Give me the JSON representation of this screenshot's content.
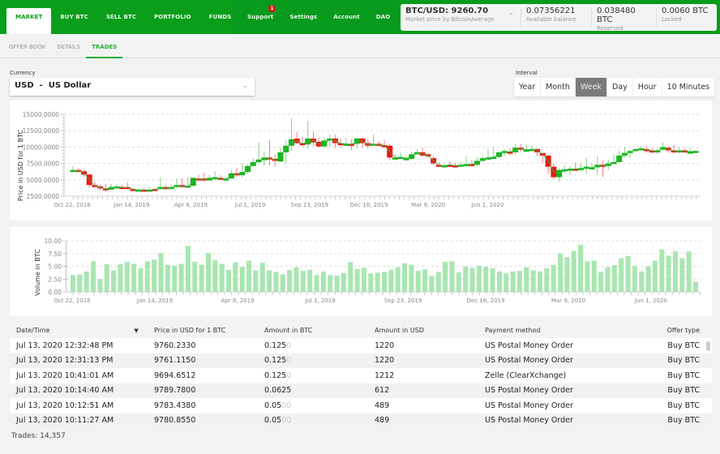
{
  "nav": {
    "left": [
      "MARKET",
      "BUY BTC",
      "SELL BTC",
      "PORTFOLIO",
      "FUNDS"
    ],
    "active": "MARKET",
    "right": [
      "Support",
      "Settings",
      "Account",
      "DAO"
    ],
    "support_badge": "1"
  },
  "market": {
    "price": "BTC/USD: 9260.70",
    "price_source": "Market price by BitcoinAverage",
    "available_balance": "0.07356221",
    "available_label": "Available balance",
    "reserved": "0.038480 BTC",
    "reserved_label": "Reserved",
    "locked": "0.0060 BTC",
    "locked_label": "Locked"
  },
  "tabs": [
    "OFFER BOOK",
    "DETAILS",
    "TRADES"
  ],
  "active_tab": "TRADES",
  "currency": {
    "label": "Currency",
    "value": "USD  -  US Dollar"
  },
  "interval": {
    "label": "Interval",
    "options": [
      "Year",
      "Month",
      "Week",
      "Day",
      "Hour",
      "10 Minutes"
    ],
    "selected": "Week"
  },
  "colors": {
    "brand": "#0b9e1b",
    "up": "#17b51b",
    "down": "#f01616",
    "volume": "#a8e6b0"
  },
  "chart_data": [
    {
      "type": "candlestick",
      "ylabel": "Price in USD for 1 BTC",
      "ylim": [
        2500,
        15000
      ],
      "yticks": [
        "15000.0000",
        "12500.0000",
        "10000.0000",
        "7500.0000",
        "5000.0000",
        "2500.0000"
      ],
      "xticks": [
        "Oct 22, 2018",
        "Jan 14, 2019",
        "Apr 8, 2019",
        "Jul 1, 2019",
        "Sep 23, 2019",
        "Dec 16, 2019",
        "Mar 9, 2020",
        "Jun 1, 2020"
      ],
      "grid": true,
      "candles": [
        [
          6300,
          6500,
          7100,
          6200
        ],
        [
          6500,
          6300,
          6800,
          6200
        ],
        [
          6300,
          5800,
          6600,
          5500
        ],
        [
          5800,
          4200,
          5900,
          3800
        ],
        [
          4200,
          4000,
          4700,
          3900
        ],
        [
          4000,
          3700,
          4300,
          3300
        ],
        [
          3700,
          3400,
          4400,
          3200
        ],
        [
          3500,
          3900,
          4400,
          3400
        ],
        [
          3900,
          4000,
          4300,
          3600
        ],
        [
          3900,
          3800,
          4200,
          3600
        ],
        [
          3900,
          3700,
          4600,
          3500
        ],
        [
          3600,
          3500,
          3800,
          3400
        ],
        [
          3400,
          3500,
          3700,
          3300
        ],
        [
          3500,
          3400,
          3700,
          3300
        ],
        [
          3400,
          3500,
          3900,
          3300
        ],
        [
          3600,
          3400,
          3700,
          3300
        ],
        [
          3600,
          3900,
          5300,
          3500
        ],
        [
          3900,
          3600,
          4200,
          3500
        ],
        [
          3700,
          3900,
          4300,
          3700
        ],
        [
          3900,
          4200,
          5200,
          3800
        ],
        [
          4200,
          3900,
          5200,
          3800
        ],
        [
          3900,
          4100,
          5400,
          3900
        ],
        [
          4100,
          5300,
          5400,
          4000
        ],
        [
          5200,
          5100,
          5800,
          5000
        ],
        [
          5200,
          4900,
          6100,
          4800
        ],
        [
          4900,
          5300,
          5800,
          4900
        ],
        [
          5200,
          5400,
          6300,
          5000
        ],
        [
          5300,
          5000,
          5700,
          5000
        ],
        [
          5000,
          5200,
          5500,
          4900
        ],
        [
          5200,
          6000,
          6500,
          5200
        ],
        [
          6000,
          5800,
          6800,
          5500
        ],
        [
          5700,
          6200,
          7600,
          5300
        ],
        [
          6200,
          7100,
          7400,
          5900
        ],
        [
          7100,
          7700,
          8300,
          7100
        ],
        [
          7700,
          8100,
          10700,
          7400
        ],
        [
          8000,
          8400,
          9300,
          7200
        ],
        [
          8400,
          8200,
          11000,
          7200
        ],
        [
          8200,
          7900,
          8900,
          7000
        ],
        [
          7800,
          9200,
          9900,
          7700
        ],
        [
          9200,
          10200,
          11000,
          7500
        ],
        [
          10200,
          11200,
          14400,
          9500
        ],
        [
          11300,
          10600,
          12300,
          10500
        ],
        [
          10600,
          10400,
          11500,
          10000
        ],
        [
          10400,
          11300,
          14000,
          9800
        ],
        [
          11300,
          10700,
          12300,
          10200
        ],
        [
          10800,
          10100,
          11500,
          9900
        ],
        [
          10100,
          11000,
          11400,
          9900
        ],
        [
          11000,
          11300,
          12000,
          10100
        ],
        [
          11300,
          10600,
          11900,
          9800
        ],
        [
          10600,
          10500,
          11300,
          9900
        ],
        [
          10500,
          10500,
          11400,
          10300
        ],
        [
          10500,
          10300,
          11200,
          9500
        ],
        [
          10500,
          11300,
          11400,
          9900
        ],
        [
          11300,
          10600,
          11500,
          9900
        ],
        [
          10600,
          10200,
          11200,
          9800
        ],
        [
          10300,
          10500,
          11900,
          10200
        ],
        [
          10500,
          10300,
          10900,
          10000
        ],
        [
          10300,
          10200,
          11100,
          9800
        ],
        [
          10200,
          8400,
          10500,
          8000
        ],
        [
          8400,
          8400,
          8900,
          8200
        ],
        [
          8400,
          8500,
          9200,
          8300
        ],
        [
          8300,
          8300,
          8600,
          8100
        ],
        [
          8200,
          8900,
          9300,
          8100
        ],
        [
          8900,
          9200,
          9700,
          8900
        ],
        [
          9200,
          8700,
          9900,
          8500
        ],
        [
          8900,
          8600,
          9100,
          8300
        ],
        [
          8300,
          7500,
          8600,
          7300
        ],
        [
          7300,
          7100,
          7700,
          7000
        ],
        [
          7100,
          7200,
          7500,
          6900
        ],
        [
          7300,
          7200,
          7800,
          6900
        ],
        [
          7200,
          7100,
          7600,
          7000
        ],
        [
          7100,
          7300,
          7700,
          7000
        ],
        [
          7300,
          7400,
          8600,
          7000
        ],
        [
          7400,
          7300,
          8000,
          7100
        ],
        [
          7300,
          7900,
          8500,
          7000
        ],
        [
          7900,
          8300,
          8700,
          7800
        ],
        [
          8300,
          8400,
          9700,
          8000
        ],
        [
          8400,
          8500,
          10000,
          8400
        ],
        [
          8500,
          9200,
          9400,
          8300
        ],
        [
          9200,
          9400,
          9700,
          8700
        ],
        [
          9300,
          9200,
          9800,
          8700
        ],
        [
          9200,
          9900,
          10400,
          8800
        ],
        [
          9900,
          9600,
          10500,
          9300
        ],
        [
          9600,
          9600,
          10400,
          9400
        ],
        [
          9600,
          9700,
          10200,
          9400
        ],
        [
          9700,
          9200,
          9800,
          8600
        ],
        [
          9100,
          8700,
          9000,
          7600
        ],
        [
          8700,
          7000,
          7800,
          5900
        ],
        [
          7000,
          5400,
          7500,
          5100
        ],
        [
          5400,
          6500,
          6800,
          4700
        ],
        [
          6300,
          6600,
          7200,
          6000
        ],
        [
          6600,
          6700,
          7100,
          5800
        ],
        [
          6700,
          6600,
          7600,
          6500
        ],
        [
          6600,
          6800,
          7500,
          6200
        ],
        [
          6800,
          7000,
          8400,
          5900
        ],
        [
          6800,
          6900,
          7500,
          6700
        ],
        [
          6900,
          7300,
          8700,
          5800
        ],
        [
          7300,
          7000,
          7900,
          5400
        ],
        [
          7100,
          7500,
          8100,
          6500
        ],
        [
          7400,
          7700,
          8900,
          7400
        ],
        [
          7700,
          8700,
          9500,
          8500
        ],
        [
          8700,
          9100,
          10000,
          8400
        ],
        [
          9100,
          9400,
          9600,
          8300
        ],
        [
          9400,
          9700,
          9800,
          9200
        ],
        [
          9700,
          9800,
          10100,
          9600
        ],
        [
          9700,
          9500,
          10100,
          9100
        ],
        [
          9500,
          9300,
          9900,
          9100
        ],
        [
          9300,
          9500,
          10000,
          8900
        ],
        [
          9600,
          10000,
          10700,
          9500
        ],
        [
          9900,
          9500,
          10100,
          9200
        ],
        [
          9500,
          9300,
          10300,
          9100
        ],
        [
          9300,
          9500,
          10000,
          9000
        ],
        [
          9500,
          9300,
          9800,
          9200
        ],
        [
          9300,
          9300,
          9900,
          9100
        ],
        [
          9300,
          9400,
          9500,
          9100
        ]
      ]
    },
    {
      "type": "bar",
      "ylabel": "Volume in BTC",
      "ylim": [
        0,
        10
      ],
      "yticks": [
        "10.00",
        "7.50",
        "5.00",
        "2.50",
        "0.00"
      ],
      "xticks": [
        "Oct 22, 2018",
        "Jan 14, 2019",
        "Apr 8, 2019",
        "Jul 1, 2019",
        "Sep 23, 2019",
        "Dec 16, 2019",
        "Mar 9, 2020",
        "Jun 1, 2020"
      ],
      "grid": true,
      "values": [
        3.3,
        3.4,
        4.0,
        6.0,
        2.5,
        5.4,
        4.2,
        5.4,
        5.9,
        5.5,
        4.6,
        6.0,
        6.3,
        7.6,
        5.3,
        5.1,
        5.5,
        9.0,
        5.9,
        5.3,
        7.6,
        6.2,
        5.5,
        4.3,
        5.8,
        4.9,
        6.1,
        4.2,
        5.7,
        4.2,
        3.9,
        3.4,
        4.3,
        4.8,
        4.1,
        4.3,
        3.3,
        4.0,
        3.3,
        3.2,
        3.7,
        5.8,
        4.5,
        4.7,
        3.6,
        3.8,
        3.9,
        4.3,
        4.8,
        5.6,
        5.3,
        4.1,
        4.4,
        3.1,
        3.9,
        5.9,
        6.0,
        3.8,
        4.9,
        4.7,
        5.1,
        4.9,
        4.6,
        4.0,
        3.6,
        4.0,
        4.1,
        4.8,
        4.2,
        4.0,
        4.6,
        5.3,
        7.5,
        6.8,
        8.0,
        9.2,
        6.0,
        6.1,
        3.9,
        4.8,
        5.2,
        6.6,
        7.0,
        5.1,
        4.0,
        5.0,
        6.1,
        8.3,
        7.1,
        8.0,
        6.6,
        7.9,
        2.0
      ]
    }
  ],
  "table": {
    "headers": [
      "Date/Time",
      "Price in USD for 1 BTC",
      "Amount in BTC",
      "Amount in USD",
      "Payment method",
      "Offer type"
    ],
    "sort_indicator": "▼",
    "rows": [
      {
        "date": "Jul 13, 2020 12:32:48 PM",
        "price": "9760.2330",
        "amount": "0.125",
        "amount_pad": "0",
        "usd": "1220",
        "method": "US Postal Money Order",
        "type": "Buy BTC"
      },
      {
        "date": "Jul 13, 2020 12:31:13 PM",
        "price": "9761.1150",
        "amount": "0.125",
        "amount_pad": "0",
        "usd": "1220",
        "method": "US Postal Money Order",
        "type": "Buy BTC"
      },
      {
        "date": "Jul 13, 2020 10:41:01 AM",
        "price": "9694.6512",
        "amount": "0.125",
        "amount_pad": "0",
        "usd": "1212",
        "method": "Zelle (ClearXchange)",
        "type": "Buy BTC"
      },
      {
        "date": "Jul 13, 2020 10:14:40 AM",
        "price": "9789.7800",
        "amount": "0.0625",
        "amount_pad": "",
        "usd": "612",
        "method": "US Postal Money Order",
        "type": "Buy BTC"
      },
      {
        "date": "Jul 13, 2020 10:12:51 AM",
        "price": "9783.4380",
        "amount": "0.05",
        "amount_pad": "00",
        "usd": "489",
        "method": "US Postal Money Order",
        "type": "Buy BTC"
      },
      {
        "date": "Jul 13, 2020 10:11:27 AM",
        "price": "9780.8550",
        "amount": "0.05",
        "amount_pad": "00",
        "usd": "489",
        "method": "US Postal Money Order",
        "type": "Buy BTC"
      }
    ]
  },
  "footer": {
    "trades_count": "Trades: 14,357"
  }
}
